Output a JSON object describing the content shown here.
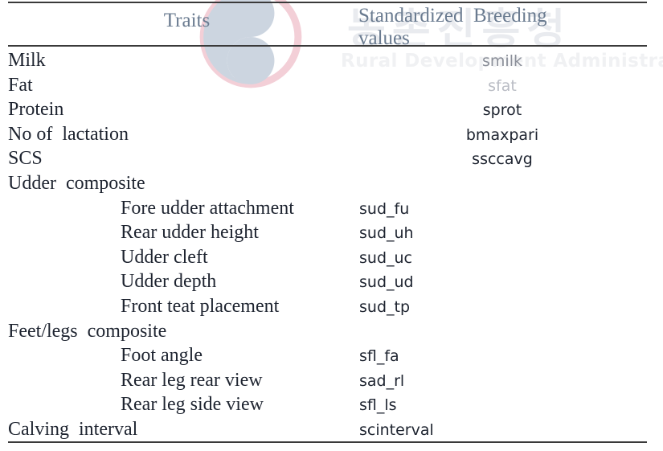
{
  "watermark": {
    "hangul_text": "농촌진흥청",
    "english_text": "Rural Development Administrat",
    "taegeuk_icon": "taegeuk-icon",
    "colors": {
      "blue": "#ccd5e0",
      "red": "#f2ccd4",
      "text": "#eff0f3"
    }
  },
  "table": {
    "headers": {
      "traits": "Traits",
      "breeding_values": "Standardized  Breeding\nvalues"
    },
    "rows": [
      {
        "trait": "Milk",
        "code": "smilk",
        "indent": false,
        "code_align": "center"
      },
      {
        "trait": "Fat",
        "code": "sfat",
        "indent": false,
        "code_align": "center"
      },
      {
        "trait": "Protein",
        "code": "sprot",
        "indent": false,
        "code_align": "center"
      },
      {
        "trait": "No of  lactation",
        "code": "bmaxpari",
        "indent": false,
        "code_align": "center"
      },
      {
        "trait": "SCS",
        "code": "ssccavg",
        "indent": false,
        "code_align": "center"
      },
      {
        "trait": "Udder  composite",
        "code": "",
        "indent": false,
        "code_align": "left"
      },
      {
        "trait": "Fore udder attachment",
        "code": "sud_fu",
        "indent": true,
        "code_align": "left"
      },
      {
        "trait": "Rear udder height",
        "code": "sud_uh",
        "indent": true,
        "code_align": "left"
      },
      {
        "trait": "Udder cleft",
        "code": "sud_uc",
        "indent": true,
        "code_align": "left"
      },
      {
        "trait": "Udder depth",
        "code": "sud_ud",
        "indent": true,
        "code_align": "left"
      },
      {
        "trait": "Front teat placement",
        "code": "sud_tp",
        "indent": true,
        "code_align": "left"
      },
      {
        "trait": "Feet/legs  composite",
        "code": "",
        "indent": false,
        "code_align": "left"
      },
      {
        "trait": "Foot angle",
        "code": "sfl_fa",
        "indent": true,
        "code_align": "left"
      },
      {
        "trait": "Rear leg rear view",
        "code": "sad_rl",
        "indent": true,
        "code_align": "left"
      },
      {
        "trait": "Rear leg side view",
        "code": "sfl_ls",
        "indent": true,
        "code_align": "left"
      },
      {
        "trait": "Calving  interval",
        "code": "scinterval",
        "indent": false,
        "code_align": "left"
      }
    ]
  }
}
